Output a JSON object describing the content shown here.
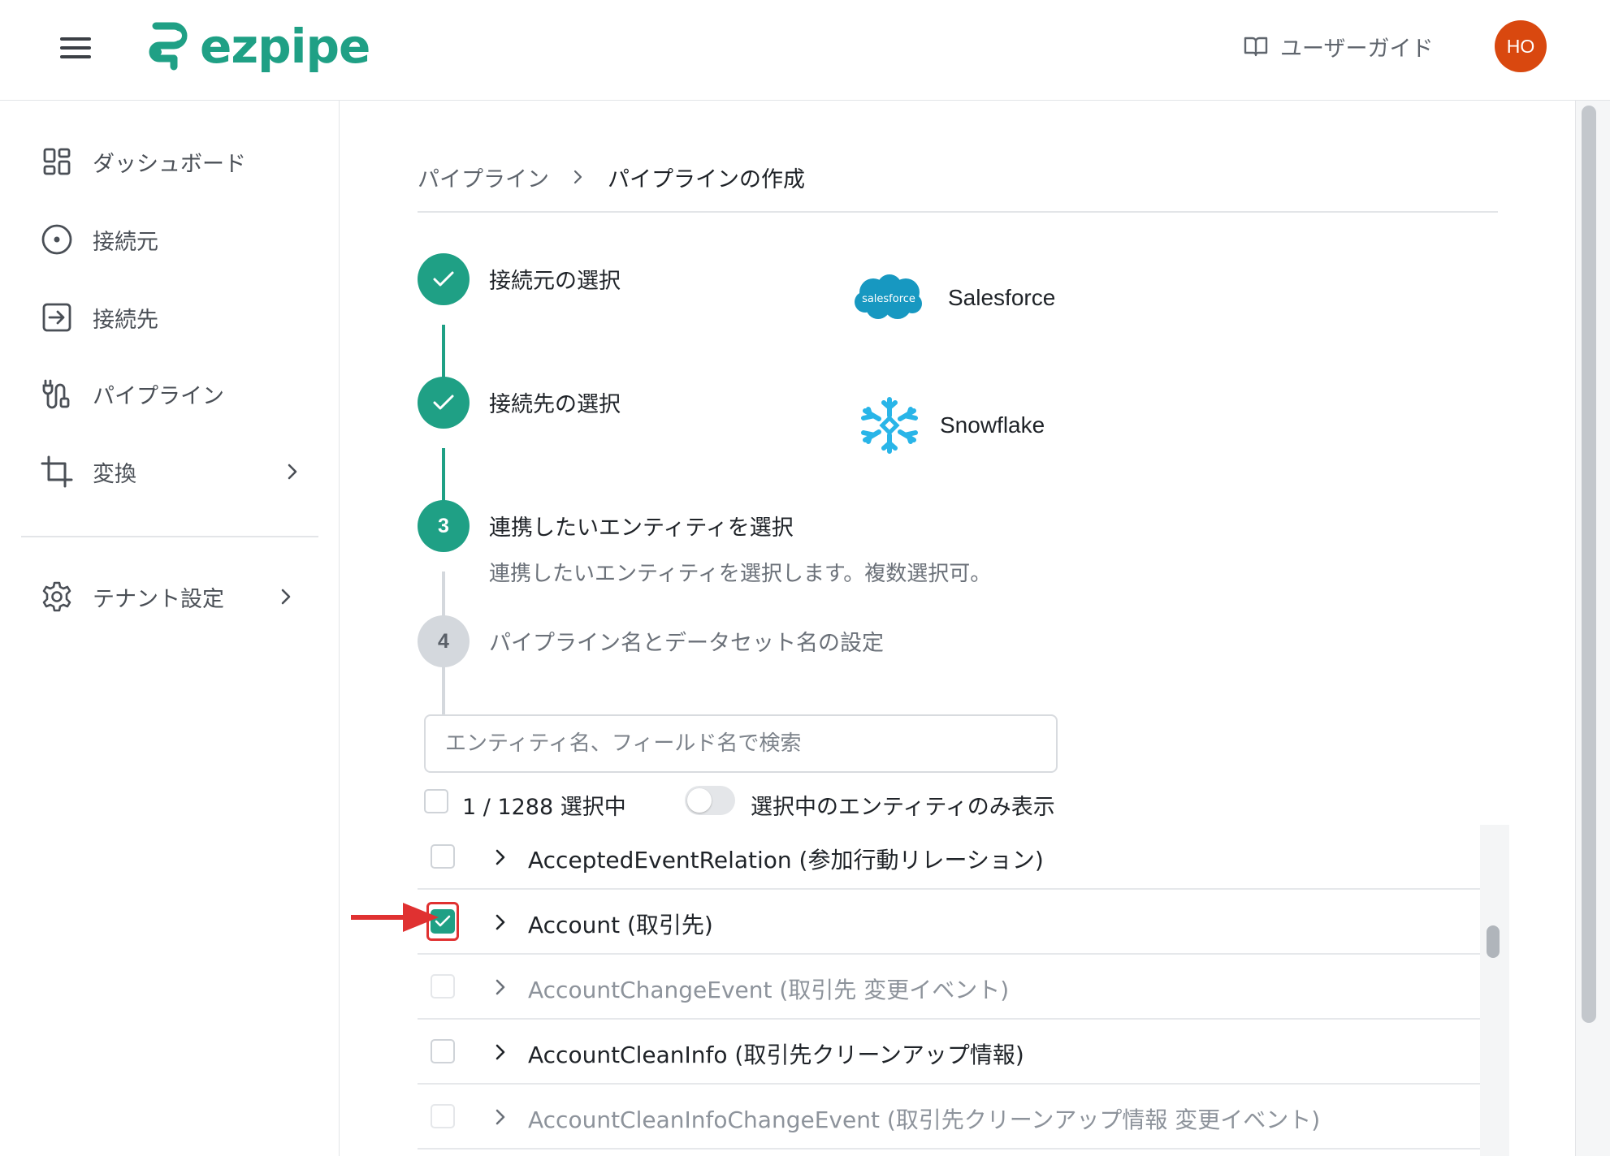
{
  "header": {
    "logo_text": "ezpipe",
    "guide_label": "ユーザーガイド",
    "avatar_initials": "HO",
    "brand_color": "#1fa085",
    "avatar_color": "#d9480f"
  },
  "sidebar": {
    "items": [
      {
        "label": "ダッシュボード",
        "icon": "dashboard-icon"
      },
      {
        "label": "接続元",
        "icon": "source-icon"
      },
      {
        "label": "接続先",
        "icon": "destination-icon"
      },
      {
        "label": "パイプライン",
        "icon": "pipeline-icon"
      },
      {
        "label": "変換",
        "icon": "crop-icon",
        "has_submenu": true
      },
      {
        "label": "テナント設定",
        "icon": "gear-icon",
        "has_submenu": true
      }
    ]
  },
  "breadcrumb": {
    "parent": "パイプライン",
    "current": "パイプラインの作成"
  },
  "steps": [
    {
      "title": "接続元の選択",
      "status": "done",
      "connector": "Salesforce",
      "connector_logo_text": "salesforce"
    },
    {
      "title": "接続先の選択",
      "status": "done",
      "connector": "Snowflake"
    },
    {
      "number": "3",
      "title": "連携したいエンティティを選択",
      "status": "active",
      "description": "連携したいエンティティを選択します。複数選択可。"
    },
    {
      "number": "4",
      "title": "パイプライン名とデータセット名の設定",
      "status": "pending"
    }
  ],
  "entity_picker": {
    "search_placeholder": "エンティティ名、フィールド名で検索",
    "selected_count": "1 / 1288 選択中",
    "show_selected_only_label": "選択中のエンティティのみ表示",
    "show_selected_only": false,
    "rows": [
      {
        "label": "AcceptedEventRelation (参加行動リレーション)",
        "checked": false,
        "disabled": false
      },
      {
        "label": "Account (取引先)",
        "checked": true,
        "disabled": false,
        "highlighted": true
      },
      {
        "label": "AccountChangeEvent (取引先 変更イベント)",
        "checked": false,
        "disabled": true
      },
      {
        "label": "AccountCleanInfo (取引先クリーンアップ情報)",
        "checked": false,
        "disabled": false
      },
      {
        "label": "AccountCleanInfoChangeEvent (取引先クリーンアップ情報 変更イベント)",
        "checked": false,
        "disabled": true
      }
    ]
  }
}
